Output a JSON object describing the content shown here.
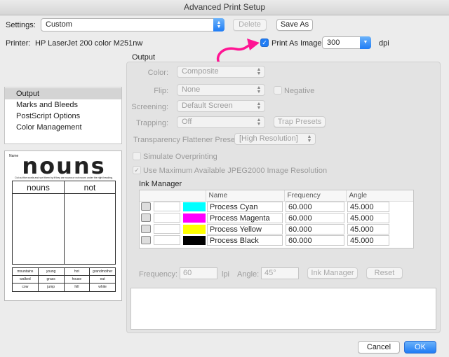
{
  "window": {
    "title": "Advanced Print Setup"
  },
  "settings": {
    "label": "Settings:",
    "value": "Custom",
    "delete_label": "Delete",
    "save_as_label": "Save As"
  },
  "printer": {
    "label": "Printer:",
    "name": "HP LaserJet 200 color M251nw",
    "print_as_image_label": "Print As Image",
    "print_as_image_checked": true,
    "dpi_value": "300",
    "dpi_unit": "dpi"
  },
  "sidebar": {
    "items": [
      {
        "label": "Output",
        "selected": true
      },
      {
        "label": "Marks and Bleeds"
      },
      {
        "label": "PostScript Options"
      },
      {
        "label": "Color Management"
      }
    ]
  },
  "worksheet": {
    "corner_tag": "Name",
    "title": "nouns",
    "subtitle": "Cut out the words and sort them by if they are nouns or not nouns under the right heading.",
    "columns": [
      "nouns",
      "not"
    ],
    "words": [
      [
        "mountains",
        "young",
        "hot",
        "grandmother"
      ],
      [
        "walked",
        "grass",
        "house",
        "eat"
      ],
      [
        "cow",
        "jump",
        "hill",
        "white"
      ]
    ]
  },
  "output": {
    "section_title": "Output",
    "color": {
      "label": "Color:",
      "value": "Composite"
    },
    "flip": {
      "label": "Flip:",
      "value": "None",
      "negative_label": "Negative"
    },
    "screening": {
      "label": "Screening:",
      "value": "Default Screen"
    },
    "trapping": {
      "label": "Trapping:",
      "value": "Off",
      "trap_presets_label": "Trap Presets"
    },
    "flattener": {
      "label": "Transparency Flattener Preset:",
      "value": "[High Resolution]"
    },
    "simulate_overprint_label": "Simulate Overprinting",
    "jpeg2000_label": "Use Maximum Available JPEG2000 Image Resolution"
  },
  "ink_manager": {
    "title": "Ink Manager",
    "headers": [
      "Name",
      "Frequency",
      "Angle"
    ],
    "inks": [
      {
        "name": "Process Cyan",
        "frequency": "60.000",
        "angle": "45.000",
        "color": "#00ffff"
      },
      {
        "name": "Process Magenta",
        "frequency": "60.000",
        "angle": "45.000",
        "color": "#ff00ff"
      },
      {
        "name": "Process Yellow",
        "frequency": "60.000",
        "angle": "45.000",
        "color": "#ffff00"
      },
      {
        "name": "Process Black",
        "frequency": "60.000",
        "angle": "45.000",
        "color": "#000000"
      }
    ],
    "frequency_label": "Frequency:",
    "frequency_value": "60",
    "lpi_label": "lpi",
    "angle_label": "Angle:",
    "angle_value": "45°",
    "ink_manager_button": "Ink Manager",
    "reset_button": "Reset"
  },
  "footer": {
    "cancel_label": "Cancel",
    "ok_label": "OK"
  },
  "annotation_color": "#ff1493"
}
